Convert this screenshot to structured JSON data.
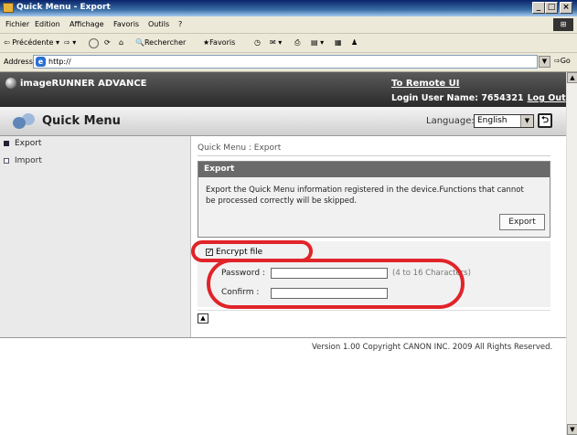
{
  "window": {
    "title": "Quick Menu - Export"
  },
  "menubar": [
    "Fichier",
    "Edition",
    "Affichage",
    "Favoris",
    "Outils",
    "?"
  ],
  "toolbar": {
    "back": "Précédente",
    "search": "Rechercher",
    "favorites": "Favoris"
  },
  "address": {
    "label": "Address",
    "url": "http://",
    "go": "Go"
  },
  "header": {
    "brand": "imageRUNNER ADVANCE",
    "remote_link": "To Remote UI",
    "login_label": "Login User Name: 7654321",
    "logout": "Log Out"
  },
  "subheader": {
    "title": "Quick Menu",
    "language_label": "Language:",
    "language_value": "English"
  },
  "sidebar": {
    "items": [
      {
        "label": "Export",
        "selected": true
      },
      {
        "label": "Import",
        "selected": false
      }
    ]
  },
  "main": {
    "breadcrumb": "Quick Menu : Export",
    "export_section": {
      "heading": "Export",
      "description": "Export the Quick Menu information registered in the device.Functions that cannot be processed correctly will be skipped.",
      "button": "Export"
    },
    "encrypt": {
      "checkbox_label": "Encrypt file",
      "checked": true,
      "password_label": "Password :",
      "password_value": "",
      "password_hint": "(4 to 16 Characters)",
      "confirm_label": "Confirm :",
      "confirm_value": ""
    }
  },
  "footer": {
    "text": "Version 1.00 Copyright CANON INC. 2009 All Rights Reserved."
  },
  "colors": {
    "annotation_red": "#e0242a",
    "header_dark": "#2a2a2a",
    "section_header": "#6a6a6a"
  }
}
